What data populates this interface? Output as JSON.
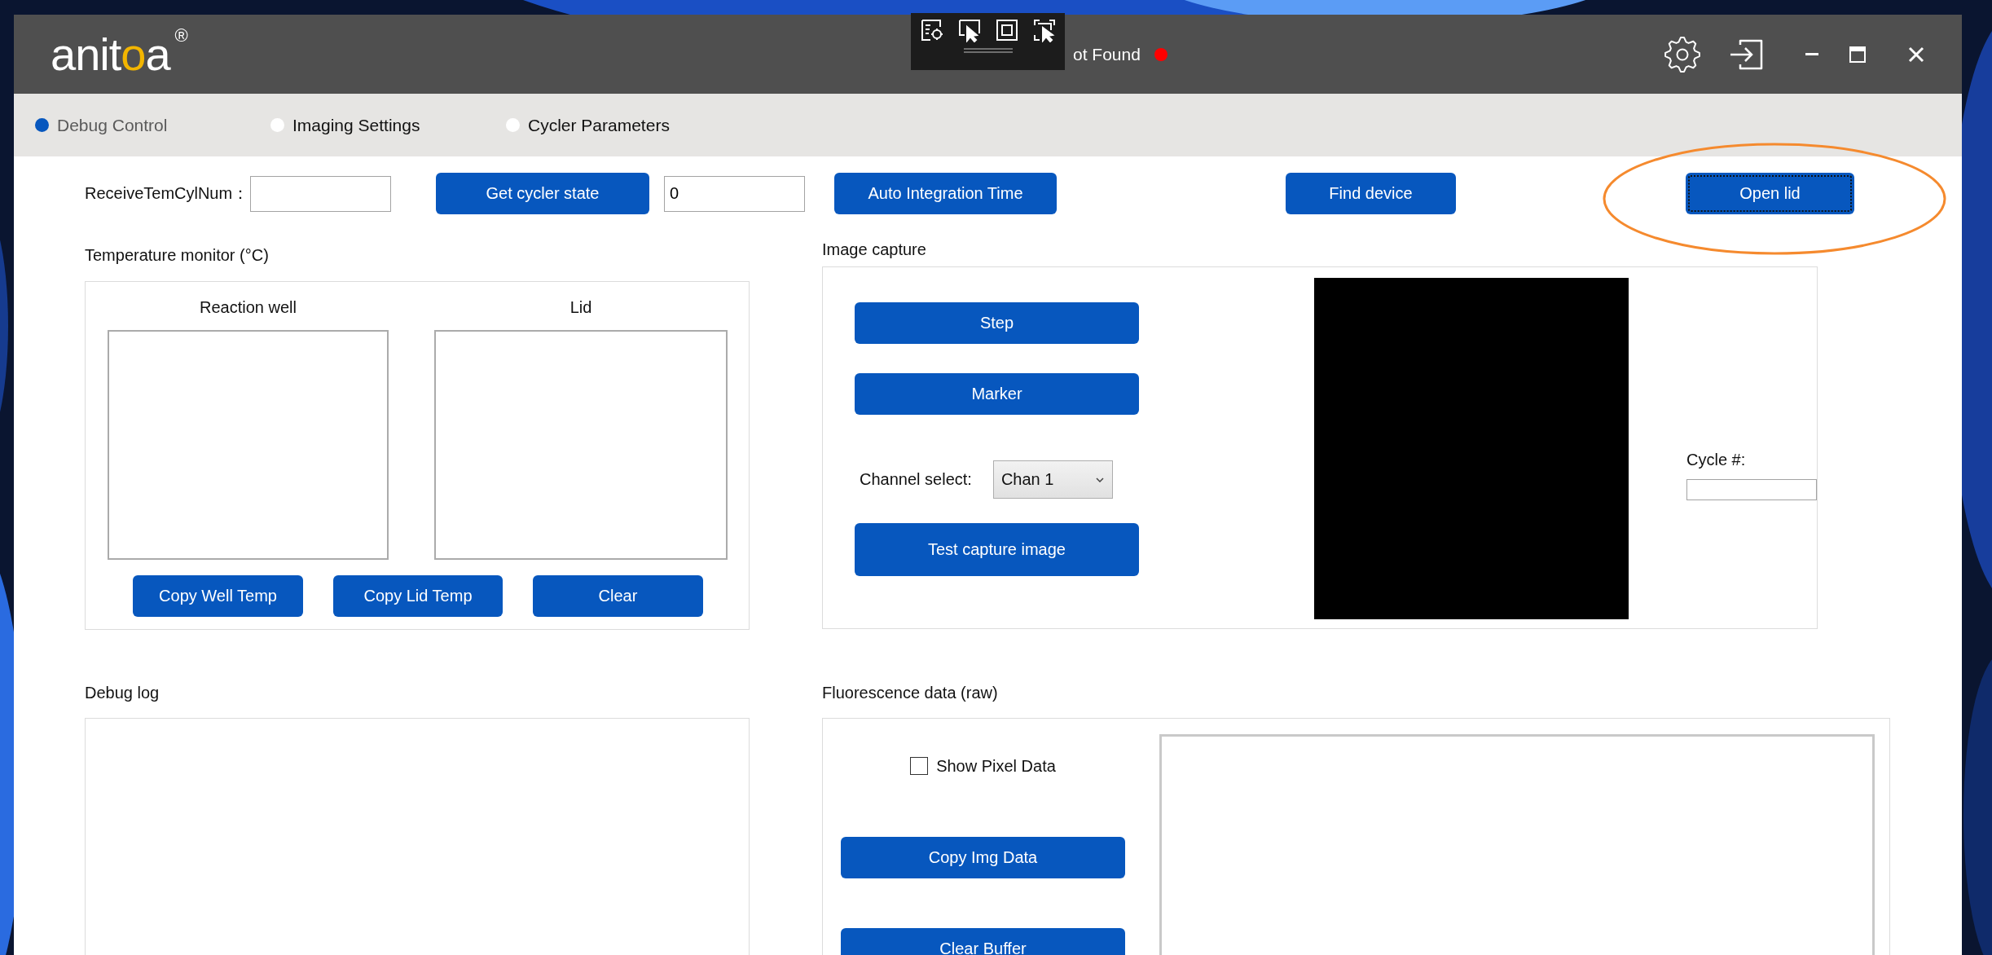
{
  "window": {
    "logo": [
      {
        "text": "anit",
        "accent": false
      },
      {
        "text": "o",
        "accent": true
      },
      {
        "text": "a",
        "accent": false
      }
    ],
    "logo_mark": "®",
    "status": "ot Found"
  },
  "tabs": [
    {
      "label": "Debug Control",
      "selected": true
    },
    {
      "label": "Imaging Settings",
      "selected": false
    },
    {
      "label": "Cycler Parameters",
      "selected": false
    }
  ],
  "toolbar": [
    {
      "kind": "label",
      "text": "ReceiveTemCylNum："
    },
    {
      "kind": "field"
    },
    {
      "kind": "button",
      "label": "Get cycler state",
      "focused": false,
      "highlighted": false
    },
    {
      "kind": "field",
      "value": "0"
    },
    {
      "kind": "button",
      "label": "Auto Integration Time",
      "focused": false,
      "highlighted": false
    },
    {
      "kind": "button",
      "label": "Find device",
      "focused": false,
      "highlighted": false
    },
    {
      "kind": "button",
      "label": "Open lid",
      "focused": true,
      "highlighted": true
    }
  ],
  "temperature_monitor": {
    "title": "Temperature monitor (°C)",
    "panes": [
      "Reaction well",
      "Lid"
    ],
    "buttons": [
      "Copy Well Temp",
      "Copy Lid Temp",
      "Clear"
    ]
  },
  "image_capture": {
    "title": "Image capture",
    "buttons": [
      "Step",
      "Marker"
    ],
    "channel_label": "Channel select:",
    "channel": "Chan 1",
    "capture_button": "Test capture image",
    "cycle_label": "Cycle #:"
  },
  "debug_log": {
    "title": "Debug log"
  },
  "fluorescence": {
    "title": "Fluorescence data (raw)",
    "checkbox": {
      "label": "Show Pixel Data",
      "checked": false
    },
    "buttons": [
      "Copy Img Data",
      "Clear Buffer"
    ]
  }
}
